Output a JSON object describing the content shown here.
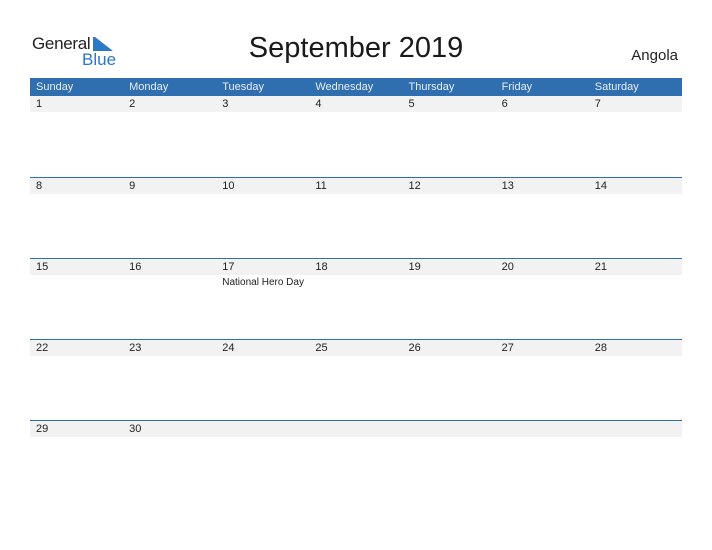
{
  "logo": {
    "line1": "General",
    "line2": "Blue"
  },
  "title": "September 2019",
  "country": "Angola",
  "colors": {
    "accent": "#2f6fb0",
    "date_strip": "#f2f2f2",
    "logo_blue": "#2a78c6"
  },
  "weekdays": [
    "Sunday",
    "Monday",
    "Tuesday",
    "Wednesday",
    "Thursday",
    "Friday",
    "Saturday"
  ],
  "weeks": [
    {
      "days": [
        "1",
        "2",
        "3",
        "4",
        "5",
        "6",
        "7"
      ],
      "events": [
        "",
        "",
        "",
        "",
        "",
        "",
        ""
      ]
    },
    {
      "days": [
        "8",
        "9",
        "10",
        "11",
        "12",
        "13",
        "14"
      ],
      "events": [
        "",
        "",
        "",
        "",
        "",
        "",
        ""
      ]
    },
    {
      "days": [
        "15",
        "16",
        "17",
        "18",
        "19",
        "20",
        "21"
      ],
      "events": [
        "",
        "",
        "National Hero Day",
        "",
        "",
        "",
        ""
      ]
    },
    {
      "days": [
        "22",
        "23",
        "24",
        "25",
        "26",
        "27",
        "28"
      ],
      "events": [
        "",
        "",
        "",
        "",
        "",
        "",
        ""
      ]
    },
    {
      "days": [
        "29",
        "30",
        "",
        "",
        "",
        "",
        ""
      ],
      "events": [
        "",
        "",
        "",
        "",
        "",
        "",
        ""
      ]
    }
  ]
}
